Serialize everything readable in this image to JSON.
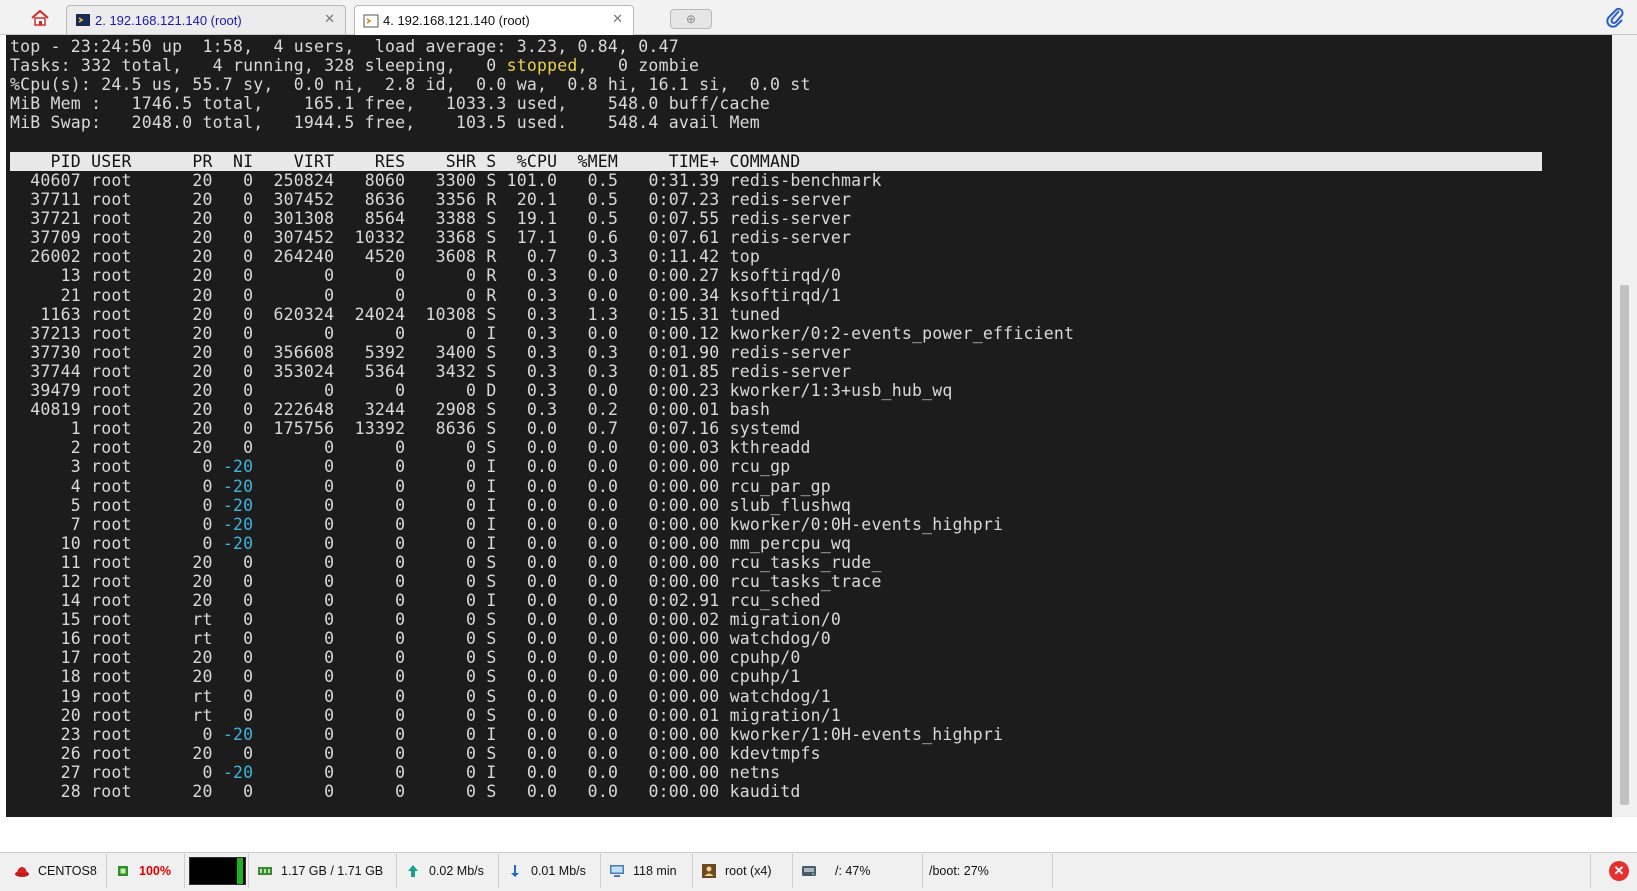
{
  "tabs": [
    {
      "label": "2. 192.168.121.140 (root)",
      "active": false
    },
    {
      "label": "4. 192.168.121.140 (root)",
      "active": true
    }
  ],
  "new_tab_symbol": "⊕",
  "summary": {
    "line1": "top - 23:24:50 up  1:58,  4 users,  load average: 3.23, 0.84, 0.47",
    "line2_pre": "Tasks: 332 total,   4 running, 328 sleeping,   0 ",
    "line2_stopped": "stopped",
    "line2_post": ",   0 zombie",
    "line3": "%Cpu(s): 24.5 us, 55.7 sy,  0.0 ni,  2.8 id,  0.0 wa,  0.8 hi, 16.1 si,  0.0 st",
    "line4": "MiB Mem :   1746.5 total,    165.1 free,   1033.3 used,    548.0 buff/cache",
    "line5": "MiB Swap:   2048.0 total,   1944.5 free,    103.5 used.    548.4 avail Mem"
  },
  "columns": [
    "PID",
    "USER",
    "PR",
    "NI",
    "VIRT",
    "RES",
    "SHR",
    "S",
    "%CPU",
    "%MEM",
    "TIME+",
    "COMMAND"
  ],
  "processes": [
    [
      "40607",
      "root",
      "20",
      "0",
      "250824",
      "8060",
      "3300",
      "S",
      "101.0",
      "0.5",
      "0:31.39",
      "redis-benchmark"
    ],
    [
      "37711",
      "root",
      "20",
      "0",
      "307452",
      "8636",
      "3356",
      "R",
      "20.1",
      "0.5",
      "0:07.23",
      "redis-server"
    ],
    [
      "37721",
      "root",
      "20",
      "0",
      "301308",
      "8564",
      "3388",
      "S",
      "19.1",
      "0.5",
      "0:07.55",
      "redis-server"
    ],
    [
      "37709",
      "root",
      "20",
      "0",
      "307452",
      "10332",
      "3368",
      "S",
      "17.1",
      "0.6",
      "0:07.61",
      "redis-server"
    ],
    [
      "26002",
      "root",
      "20",
      "0",
      "264240",
      "4520",
      "3608",
      "R",
      "0.7",
      "0.3",
      "0:11.42",
      "top"
    ],
    [
      "13",
      "root",
      "20",
      "0",
      "0",
      "0",
      "0",
      "R",
      "0.3",
      "0.0",
      "0:00.27",
      "ksoftirqd/0"
    ],
    [
      "21",
      "root",
      "20",
      "0",
      "0",
      "0",
      "0",
      "R",
      "0.3",
      "0.0",
      "0:00.34",
      "ksoftirqd/1"
    ],
    [
      "1163",
      "root",
      "20",
      "0",
      "620324",
      "24024",
      "10308",
      "S",
      "0.3",
      "1.3",
      "0:15.31",
      "tuned"
    ],
    [
      "37213",
      "root",
      "20",
      "0",
      "0",
      "0",
      "0",
      "I",
      "0.3",
      "0.0",
      "0:00.12",
      "kworker/0:2-events_power_efficient"
    ],
    [
      "37730",
      "root",
      "20",
      "0",
      "356608",
      "5392",
      "3400",
      "S",
      "0.3",
      "0.3",
      "0:01.90",
      "redis-server"
    ],
    [
      "37744",
      "root",
      "20",
      "0",
      "353024",
      "5364",
      "3432",
      "S",
      "0.3",
      "0.3",
      "0:01.85",
      "redis-server"
    ],
    [
      "39479",
      "root",
      "20",
      "0",
      "0",
      "0",
      "0",
      "D",
      "0.3",
      "0.0",
      "0:00.23",
      "kworker/1:3+usb_hub_wq"
    ],
    [
      "40819",
      "root",
      "20",
      "0",
      "222648",
      "3244",
      "2908",
      "S",
      "0.3",
      "0.2",
      "0:00.01",
      "bash"
    ],
    [
      "1",
      "root",
      "20",
      "0",
      "175756",
      "13392",
      "8636",
      "S",
      "0.0",
      "0.7",
      "0:07.16",
      "systemd"
    ],
    [
      "2",
      "root",
      "20",
      "0",
      "0",
      "0",
      "0",
      "S",
      "0.0",
      "0.0",
      "0:00.03",
      "kthreadd"
    ],
    [
      "3",
      "root",
      "0",
      "-20",
      "0",
      "0",
      "0",
      "I",
      "0.0",
      "0.0",
      "0:00.00",
      "rcu_gp"
    ],
    [
      "4",
      "root",
      "0",
      "-20",
      "0",
      "0",
      "0",
      "I",
      "0.0",
      "0.0",
      "0:00.00",
      "rcu_par_gp"
    ],
    [
      "5",
      "root",
      "0",
      "-20",
      "0",
      "0",
      "0",
      "I",
      "0.0",
      "0.0",
      "0:00.00",
      "slub_flushwq"
    ],
    [
      "7",
      "root",
      "0",
      "-20",
      "0",
      "0",
      "0",
      "I",
      "0.0",
      "0.0",
      "0:00.00",
      "kworker/0:0H-events_highpri"
    ],
    [
      "10",
      "root",
      "0",
      "-20",
      "0",
      "0",
      "0",
      "I",
      "0.0",
      "0.0",
      "0:00.00",
      "mm_percpu_wq"
    ],
    [
      "11",
      "root",
      "20",
      "0",
      "0",
      "0",
      "0",
      "S",
      "0.0",
      "0.0",
      "0:00.00",
      "rcu_tasks_rude_"
    ],
    [
      "12",
      "root",
      "20",
      "0",
      "0",
      "0",
      "0",
      "S",
      "0.0",
      "0.0",
      "0:00.00",
      "rcu_tasks_trace"
    ],
    [
      "14",
      "root",
      "20",
      "0",
      "0",
      "0",
      "0",
      "I",
      "0.0",
      "0.0",
      "0:02.91",
      "rcu_sched"
    ],
    [
      "15",
      "root",
      "rt",
      "0",
      "0",
      "0",
      "0",
      "S",
      "0.0",
      "0.0",
      "0:00.02",
      "migration/0"
    ],
    [
      "16",
      "root",
      "rt",
      "0",
      "0",
      "0",
      "0",
      "S",
      "0.0",
      "0.0",
      "0:00.00",
      "watchdog/0"
    ],
    [
      "17",
      "root",
      "20",
      "0",
      "0",
      "0",
      "0",
      "S",
      "0.0",
      "0.0",
      "0:00.00",
      "cpuhp/0"
    ],
    [
      "18",
      "root",
      "20",
      "0",
      "0",
      "0",
      "0",
      "S",
      "0.0",
      "0.0",
      "0:00.00",
      "cpuhp/1"
    ],
    [
      "19",
      "root",
      "rt",
      "0",
      "0",
      "0",
      "0",
      "S",
      "0.0",
      "0.0",
      "0:00.00",
      "watchdog/1"
    ],
    [
      "20",
      "root",
      "rt",
      "0",
      "0",
      "0",
      "0",
      "S",
      "0.0",
      "0.0",
      "0:00.01",
      "migration/1"
    ],
    [
      "23",
      "root",
      "0",
      "-20",
      "0",
      "0",
      "0",
      "I",
      "0.0",
      "0.0",
      "0:00.00",
      "kworker/1:0H-events_highpri"
    ],
    [
      "26",
      "root",
      "20",
      "0",
      "0",
      "0",
      "0",
      "S",
      "0.0",
      "0.0",
      "0:00.00",
      "kdevtmpfs"
    ],
    [
      "27",
      "root",
      "0",
      "-20",
      "0",
      "0",
      "0",
      "I",
      "0.0",
      "0.0",
      "0:00.00",
      "netns"
    ],
    [
      "28",
      "root",
      "20",
      "0",
      "0",
      "0",
      "0",
      "S",
      "0.0",
      "0.0",
      "0:00.00",
      "kauditd"
    ]
  ],
  "status": {
    "os": "CENTOS8",
    "cpu": "100%",
    "cpu_level": 1.0,
    "memory": "1.17 GB / 1.71 GB",
    "upload": "0.02 Mb/s",
    "download": "0.01 Mb/s",
    "uptime": "118 min",
    "user": "root (x4)",
    "disk_root": "/: 47%",
    "disk_boot": "/boot: 27%",
    "close_symbol": "✕"
  },
  "colors": {
    "terminal_bg": "#1c1c1c",
    "terminal_fg": "#d9d9d9",
    "stopped": "#e8d24a",
    "negative_ni": "#3fb4dc",
    "cpu_alert": "#e00000"
  }
}
